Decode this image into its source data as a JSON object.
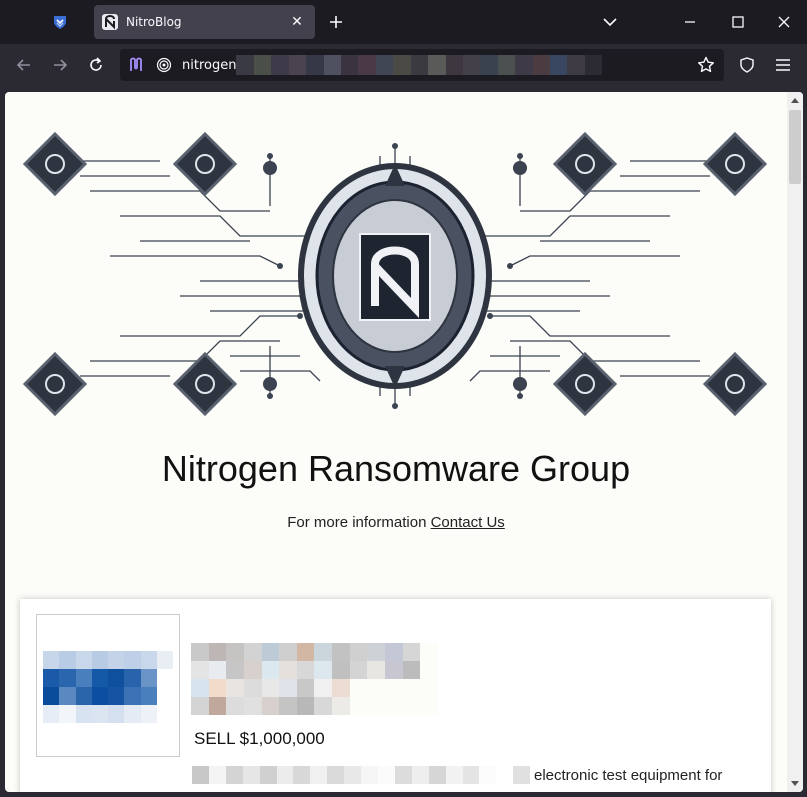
{
  "browser": {
    "tab": {
      "title": "NitroBlog",
      "close_glyph": "✕"
    },
    "new_tab_glyph": "+",
    "url": {
      "visible_text": "nitrogen"
    },
    "icons": {
      "pinned_tab": "pocket-shield-icon",
      "favicon": "nitrogen-logo-icon",
      "list_tabs": "chevron-down-icon",
      "minimize": "minimize-icon",
      "maximize": "maximize-icon",
      "close": "close-icon",
      "back": "back-arrow-icon",
      "forward": "forward-arrow-icon",
      "reload": "reload-icon",
      "extension": "extension-icon",
      "tracking": "tracking-protection-icon",
      "bookmark": "star-icon",
      "shield": "shield-icon",
      "menu": "hamburger-menu-icon"
    }
  },
  "page": {
    "site_title": "Nitrogen Ransomware Group",
    "info_prefix": "For more information ",
    "contact_link": "Contact Us",
    "post": {
      "price": "SELL $1,000,000",
      "description_visible": "electronic test equipment for"
    }
  },
  "colors": {
    "browser_bg": "#1c1b22",
    "toolbar_bg": "#2b2a33",
    "page_bg": "#fcfcf8",
    "accent_purple": "#a98eff"
  }
}
